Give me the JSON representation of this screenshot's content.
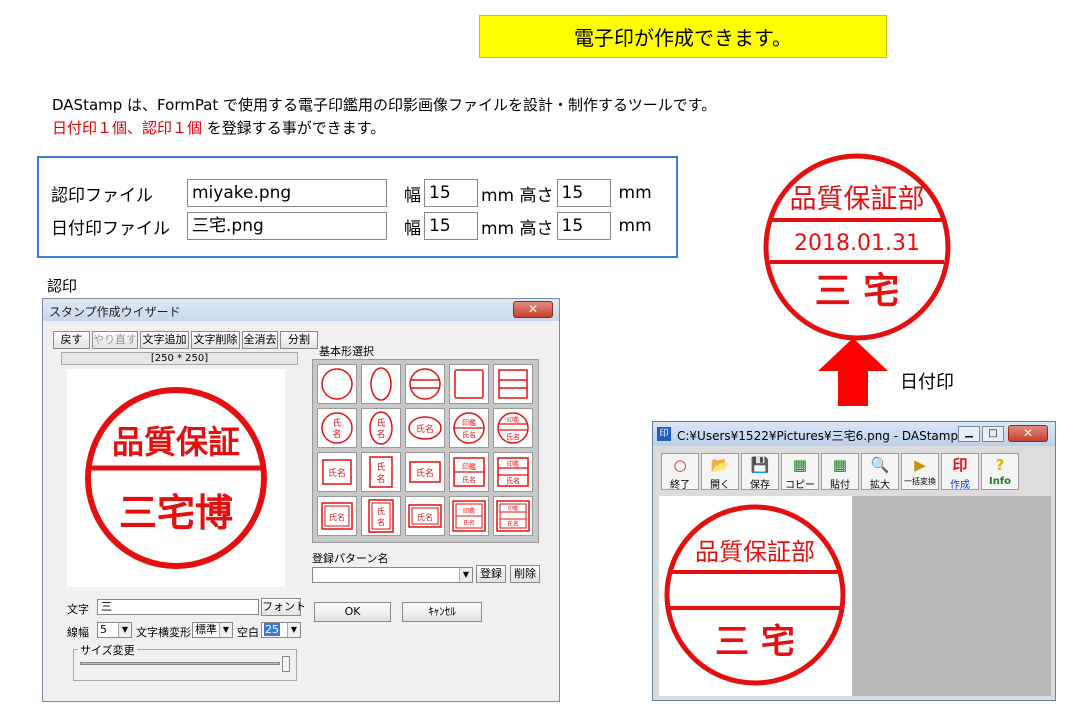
{
  "banner": "電子印が作成できます。",
  "intro": {
    "line1": "DAStamp は、FormPat で使用する電子印鑑用の印影画像ファイルを設計・制作するツールです。",
    "line2_red": "日付印１個、認印１個",
    "line2_rest": " を登録する事ができます。"
  },
  "files": {
    "ninsho_label": "認印ファイル",
    "ninsho_file": "miyake.png",
    "dated_label": "日付印ファイル",
    "dated_file": "三宅.png",
    "width_label": "幅",
    "height_label": "mm 高さ",
    "unit": "mm",
    "ninsho_width": "15",
    "ninsho_height": "15",
    "dated_width": "15",
    "dated_height": "15"
  },
  "section_ninsho": "認印",
  "dated_arrow_label": "日付印",
  "big_stamp": {
    "top": "品質保証部",
    "date": "2018.01.31",
    "name": "三 宅"
  },
  "wizard": {
    "title": "スタンプ作成ウイザード",
    "close": "✕",
    "buttons": {
      "back": "戻す",
      "redo": "やり直す",
      "add_text": "文字追加",
      "delete_text": "文字削除",
      "clear_all": "全消去",
      "split": "分割"
    },
    "size_readout": "[250 * 250]",
    "shape_section": "基本形選択",
    "preview": {
      "top": "品質保証",
      "bottom": "三宅博"
    },
    "shape_text": {
      "name": "氏名",
      "name_v1": "氏",
      "name_v2": "名",
      "inkan": "印鑑"
    },
    "pattern_label": "登録パターン名",
    "pattern_value": "",
    "register": "登録",
    "delete": "削除",
    "text_label": "文字",
    "text_value": "三",
    "font_button": "フォント",
    "linewidth_label": "線幅",
    "linewidth_value": "5",
    "transform_label": "文字横変形",
    "transform_value": "標準",
    "gap_label": "空白",
    "gap_value": "25",
    "resize_label": "サイズ変更",
    "ok": "OK",
    "cancel": "ｷｬﾝｾﾙ"
  },
  "dastamp": {
    "title": "C:¥Users¥1522¥Pictures¥三宅6.png - DAStamp",
    "toolbar": [
      {
        "label": "終了",
        "icon": "○"
      },
      {
        "label": "開く",
        "icon": "📂"
      },
      {
        "label": "保存",
        "icon": "💾"
      },
      {
        "label": "コピー",
        "icon": "▦"
      },
      {
        "label": "貼付",
        "icon": "▦"
      },
      {
        "label": "拡大",
        "icon": "🔍"
      },
      {
        "label": "一括変換",
        "icon": "▶"
      },
      {
        "label": "作成",
        "icon": "印"
      },
      {
        "label": "Info",
        "icon": "?"
      }
    ],
    "stamp": {
      "top": "品質保証部",
      "name": "三 宅"
    }
  },
  "colors": {
    "stamp_red": "#e41010",
    "banner_yellow": "#ffff00",
    "frame_blue": "#3a7bd5",
    "highlight_red": "#e00000"
  }
}
